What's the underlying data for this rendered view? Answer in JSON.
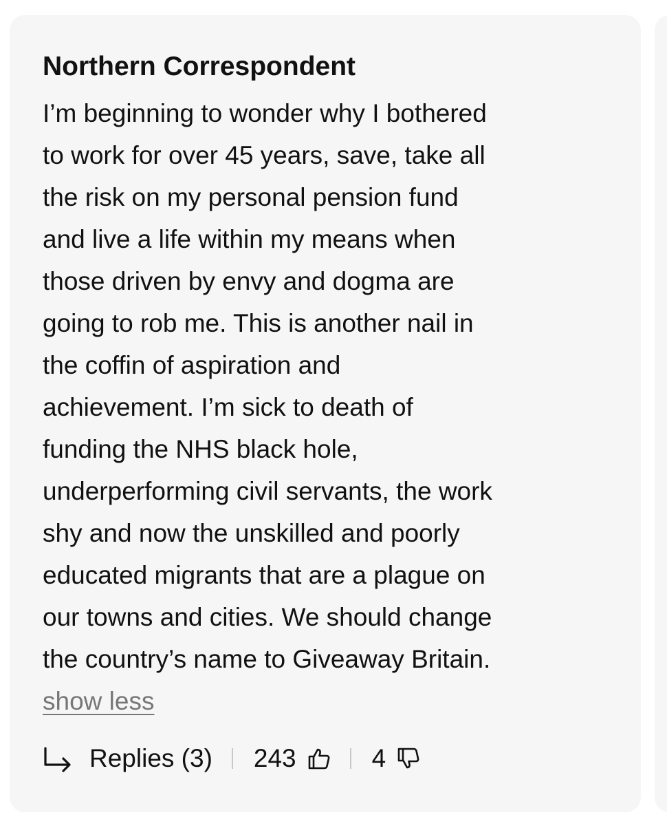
{
  "comment": {
    "author": "Northern Correspondent",
    "body_lines": [
      "I’m beginning to wonder why I bothered",
      "to work for over 45 years, save, take all",
      "the risk on my personal pension fund",
      "and live a life within my means when",
      "those driven by envy and dogma are",
      "going to rob me. This is another nail in",
      "the coffin of aspiration and",
      "achievement. I’m sick to death of",
      "funding the NHS black hole,",
      "underperforming civil servants, the work",
      "shy and now the unskilled and poorly",
      "educated migrants that are a plague on",
      "our towns and cities. We should change",
      "the country’s name to Giveaway Britain."
    ],
    "show_less_label": "show less",
    "replies_label": "Replies (3)",
    "upvotes": "243",
    "downvotes": "4"
  },
  "icons": {
    "reply": "reply-arrow-icon",
    "upvote": "thumbs-up-icon",
    "downvote": "thumbs-down-icon"
  },
  "colors": {
    "card_background": "#f6f6f6",
    "text": "#111111",
    "link_muted": "#777777",
    "separator": "#c8c8c8"
  }
}
